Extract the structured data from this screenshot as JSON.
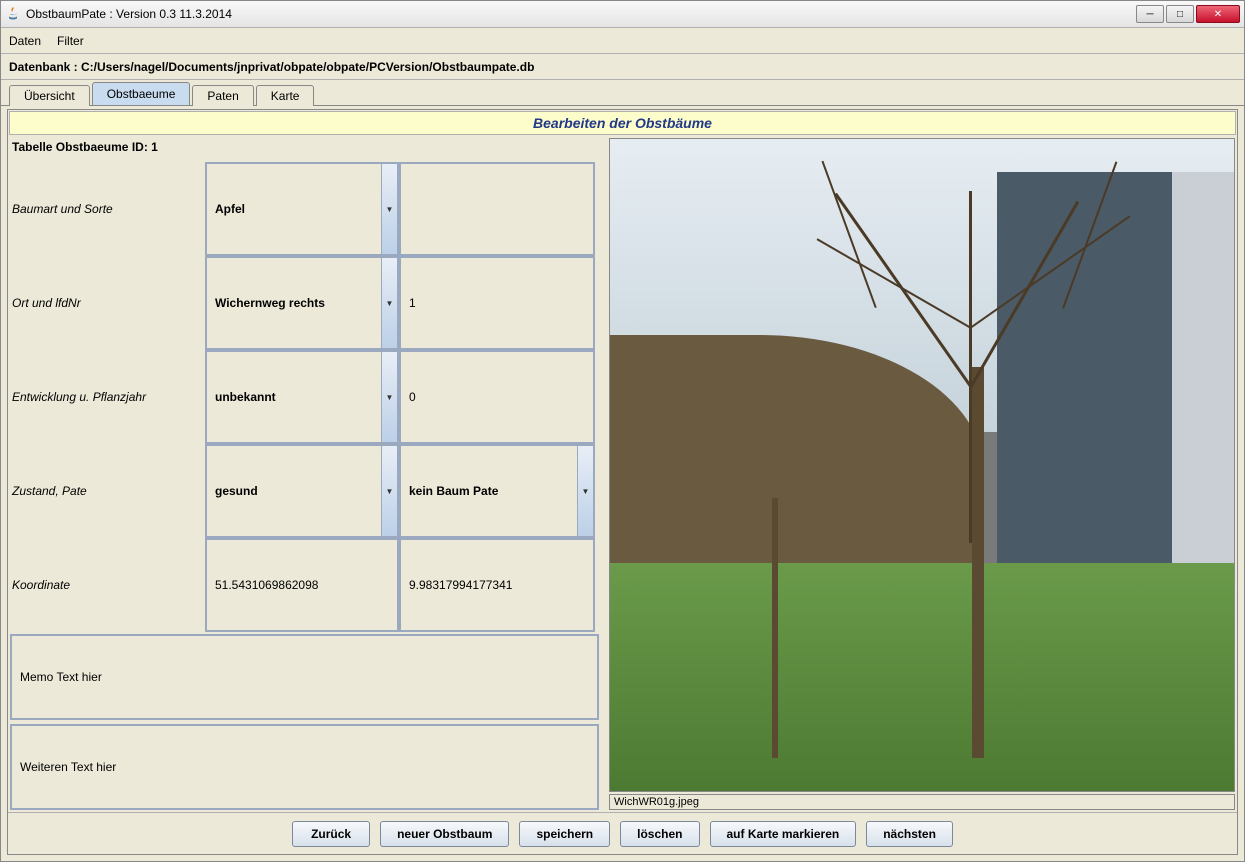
{
  "window": {
    "title": "ObstbaumPate : Version 0.3 11.3.2014"
  },
  "menu": {
    "daten": "Daten",
    "filter": "Filter"
  },
  "dbbar": "Datenbank : C:/Users/nagel/Documents/jnprivat/obpate/obpate/PCVersion/Obstbaumpate.db",
  "tabs": {
    "uebersicht": "Übersicht",
    "obstbaeume": "Obstbaeume",
    "paten": "Paten",
    "karte": "Karte"
  },
  "header": "Bearbeiten der Obstbäume",
  "form": {
    "idline": "Tabelle Obstbaeume ID: 1",
    "rows": {
      "baumart": {
        "label": "Baumart und Sorte",
        "combo": "Apfel",
        "text": ""
      },
      "ort": {
        "label": "Ort und lfdNr",
        "combo": "Wichernweg rechts",
        "text": "1"
      },
      "entw": {
        "label": "Entwicklung u. Pflanzjahr",
        "combo": "unbekannt",
        "text": "0"
      },
      "zustand": {
        "label": "Zustand, Pate",
        "combo": "gesund",
        "combo2": "kein Baum Pate"
      },
      "koord": {
        "label": "Koordinate",
        "text1": "51.5431069862098",
        "text2": "9.98317994177341"
      }
    },
    "memo1": "Memo Text hier",
    "memo2": "Weiteren Text hier"
  },
  "image": {
    "caption": "WichWR01g.jpeg"
  },
  "buttons": {
    "zurueck": "Zurück",
    "neuer": "neuer Obstbaum",
    "speichern": "speichern",
    "loeschen": "löschen",
    "markieren": "auf Karte markieren",
    "naechsten": "nächsten"
  }
}
